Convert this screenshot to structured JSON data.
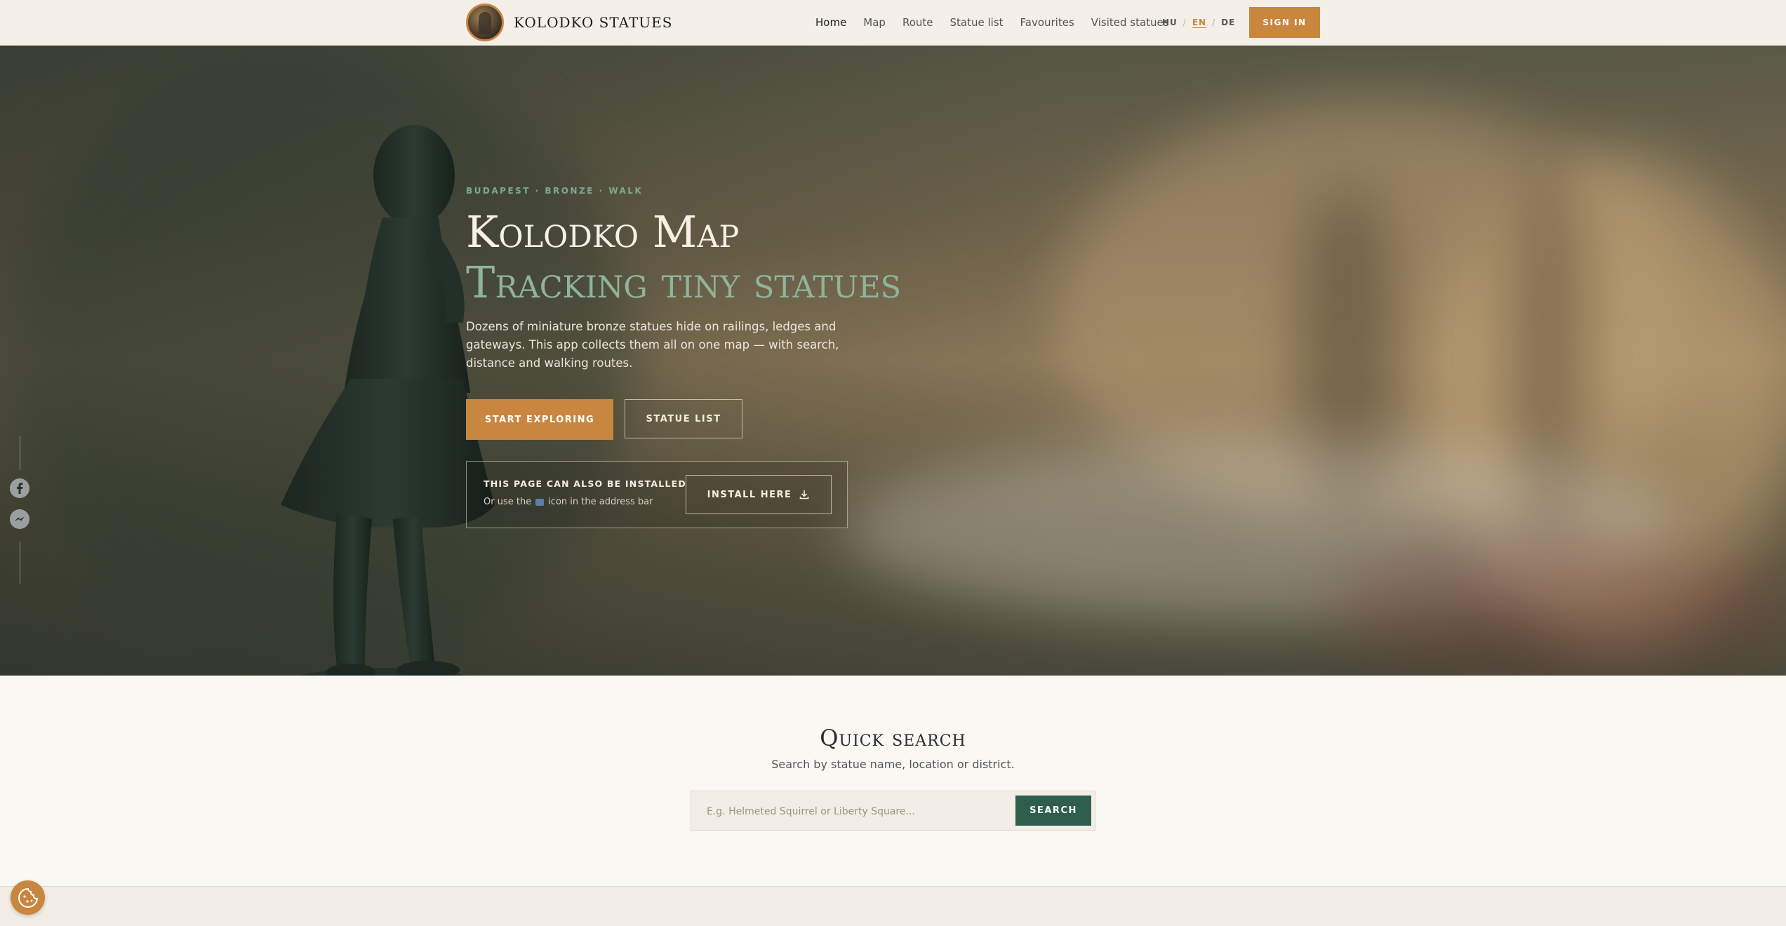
{
  "header": {
    "brand": "KOLODKO STATUES",
    "nav": [
      {
        "label": "Home",
        "active": true
      },
      {
        "label": "Map",
        "active": false
      },
      {
        "label": "Route",
        "active": false
      },
      {
        "label": "Statue list",
        "active": false
      },
      {
        "label": "Favourites",
        "active": false
      },
      {
        "label": "Visited statues",
        "active": false
      }
    ],
    "languages": [
      {
        "code": "HU",
        "active": false
      },
      {
        "code": "EN",
        "active": true
      },
      {
        "code": "DE",
        "active": false
      }
    ],
    "signin_label": "SIGN IN"
  },
  "hero": {
    "eyebrow": "BUDAPEST · BRONZE · WALK",
    "title_line1": "Kolodko Map",
    "title_line2": "Tracking tiny statues",
    "description": "Dozens of miniature bronze statues hide on railings, ledges and gateways. This app collects them all on one map — with search, distance and walking routes.",
    "primary_button": "START EXPLORING",
    "secondary_button": "STATUE LIST",
    "install": {
      "title": "THIS PAGE CAN ALSO BE INSTALLED",
      "sub_before": "Or use the",
      "sub_after": "icon in the address bar",
      "button": "INSTALL HERE"
    }
  },
  "quick_search": {
    "title": "Quick search",
    "subtitle": "Search by statue name, location or district.",
    "placeholder": "E.g. Helmeted Squirrel or Liberty Square...",
    "button": "SEARCH"
  },
  "icons": {
    "logo": "statue-logo",
    "facebook": "facebook-icon",
    "messenger": "messenger-icon",
    "download": "download-icon",
    "cookie": "cookie-icon"
  },
  "colors": {
    "accent": "#c8863f",
    "green": "#2f5e4e",
    "sage": "#8fb49b",
    "background": "#faf8f3"
  }
}
